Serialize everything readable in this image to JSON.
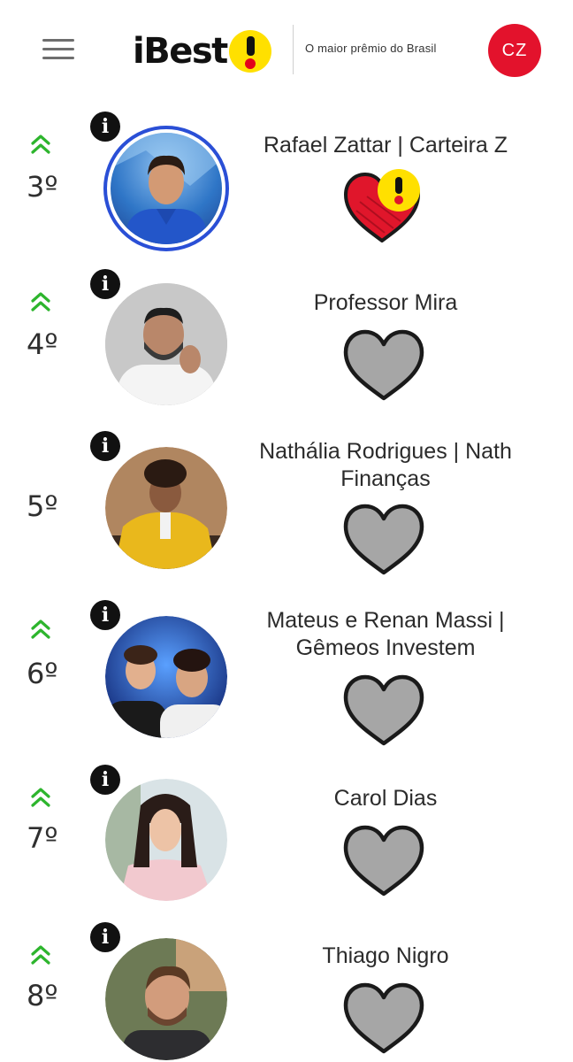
{
  "header": {
    "menu_icon": "hamburger-menu-icon",
    "logo_text": "iBest",
    "tagline": "O  maior prêmio do Brasil",
    "user_initials": "CZ",
    "colors": {
      "brand_red": "#e3001b",
      "brand_yellow": "#ffe000",
      "avatar_red": "#e3122c"
    }
  },
  "rankings": [
    {
      "rank": "3º",
      "name": "Rafael Zattar | Carteira Z",
      "trend": "up",
      "voted": true
    },
    {
      "rank": "4º",
      "name": "Professor Mira",
      "trend": "up",
      "voted": false
    },
    {
      "rank": "5º",
      "name": "Nathália Rodrigues | Nath Finanças",
      "trend": "none",
      "voted": false
    },
    {
      "rank": "6º",
      "name": "Mateus e Renan Massi | Gêmeos Investem",
      "trend": "up",
      "voted": false
    },
    {
      "rank": "7º",
      "name": "Carol Dias",
      "trend": "up",
      "voted": false
    },
    {
      "rank": "8º",
      "name": "Thiago Nigro",
      "trend": "up",
      "voted": false
    }
  ],
  "info_label": "i",
  "colors": {
    "trend_up": "#2db52d",
    "heart_empty": "#a6a6a6",
    "heart_voted": "#e0162b",
    "highlight_ring": "#2a4fd6"
  }
}
